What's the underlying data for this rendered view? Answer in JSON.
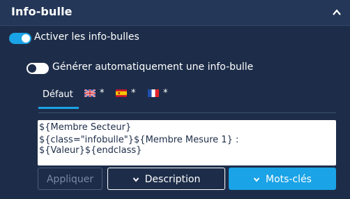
{
  "section": {
    "title": "Info-bulle"
  },
  "toggles": [
    {
      "label": "Activer les info-bulles",
      "on": true
    },
    {
      "label": "Générer automatiquement une info-bulle",
      "on": false
    }
  ],
  "tabs": [
    {
      "label": "Défaut",
      "active": true
    },
    {
      "flag": "uk-flag",
      "marker": "*"
    },
    {
      "flag": "spain-flag",
      "marker": "*"
    },
    {
      "flag": "france-flag",
      "marker": "*"
    }
  ],
  "editor": {
    "line1": "${Membre Secteur}",
    "line2": "${class=\"infobulle\"}${Membre Mesure 1} : ${Valeur}${endclass}"
  },
  "buttons": {
    "apply": "Appliquer",
    "description": "Description",
    "keywords": "Mots-clés"
  },
  "colors": {
    "background": "#1d2d49",
    "header": "#243758",
    "accent": "#1aa3e6"
  }
}
